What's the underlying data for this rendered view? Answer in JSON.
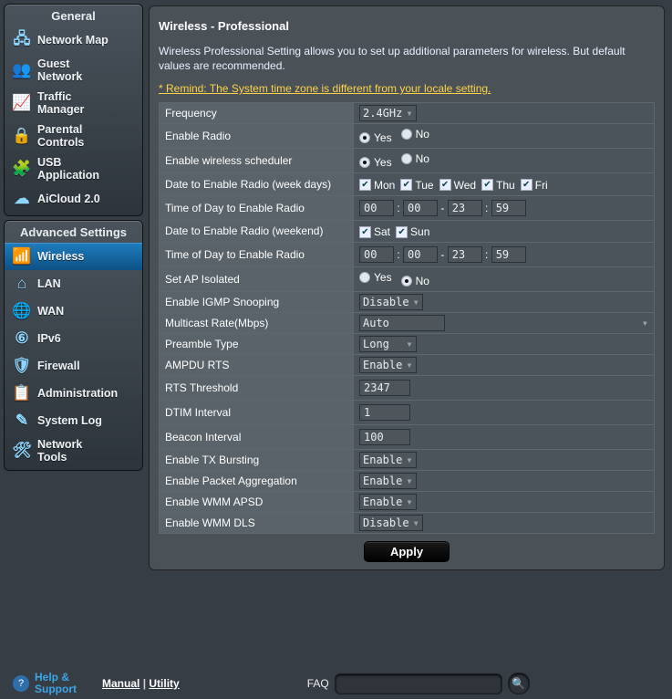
{
  "sidebar": {
    "general": {
      "header": "General",
      "items": [
        {
          "icon": "🖧",
          "label": "Network Map"
        },
        {
          "icon": "👥",
          "label": "Guest\nNetwork"
        },
        {
          "icon": "📈",
          "label": "Traffic\nManager"
        },
        {
          "icon": "🔒",
          "label": "Parental\nControls"
        },
        {
          "icon": "🧩",
          "label": "USB\nApplication"
        },
        {
          "icon": "☁",
          "label": "AiCloud 2.0"
        }
      ]
    },
    "advanced": {
      "header": "Advanced Settings",
      "items": [
        {
          "icon": "📶",
          "label": "Wireless",
          "active": true
        },
        {
          "icon": "⌂",
          "label": "LAN"
        },
        {
          "icon": "🌐",
          "label": "WAN"
        },
        {
          "icon": "⑥",
          "label": "IPv6"
        },
        {
          "icon": "🛡",
          "label": "Firewall"
        },
        {
          "icon": "📋",
          "label": "Administration"
        },
        {
          "icon": "✎",
          "label": "System Log"
        },
        {
          "icon": "🛠",
          "label": "Network\nTools"
        }
      ]
    }
  },
  "page": {
    "title": "Wireless - Professional",
    "description": "Wireless Professional Setting allows you to set up additional parameters for wireless. But default values are recommended.",
    "remind": "* Remind: The System time zone is different from your locale setting."
  },
  "fields": {
    "frequency": {
      "label": "Frequency",
      "value": "2.4GHz"
    },
    "enable_radio": {
      "label": "Enable Radio",
      "value": "Yes",
      "opts": [
        "Yes",
        "No"
      ]
    },
    "enable_sched": {
      "label": "Enable wireless scheduler",
      "value": "Yes",
      "opts": [
        "Yes",
        "No"
      ]
    },
    "weekdays": {
      "label": "Date to Enable Radio (week days)",
      "days": [
        "Mon",
        "Tue",
        "Wed",
        "Thu",
        "Fri"
      ]
    },
    "weekday_time": {
      "label": "Time of Day to Enable Radio",
      "h1": "00",
      "m1": "00",
      "h2": "23",
      "m2": "59"
    },
    "weekend": {
      "label": "Date to Enable Radio (weekend)",
      "days": [
        "Sat",
        "Sun"
      ]
    },
    "weekend_time": {
      "label": "Time of Day to Enable Radio",
      "h1": "00",
      "m1": "00",
      "h2": "23",
      "m2": "59"
    },
    "ap_isolated": {
      "label": "Set AP Isolated",
      "value": "No",
      "opts": [
        "Yes",
        "No"
      ]
    },
    "igmp": {
      "label": "Enable IGMP Snooping",
      "value": "Disable"
    },
    "mcast": {
      "label": "Multicast Rate(Mbps)",
      "value": "Auto"
    },
    "preamble": {
      "label": "Preamble Type",
      "value": "Long"
    },
    "ampdu": {
      "label": "AMPDU RTS",
      "value": "Enable"
    },
    "rts": {
      "label": "RTS Threshold",
      "value": "2347"
    },
    "dtim": {
      "label": "DTIM Interval",
      "value": "1"
    },
    "beacon": {
      "label": "Beacon Interval",
      "value": "100"
    },
    "txburst": {
      "label": "Enable TX Bursting",
      "value": "Enable"
    },
    "pktagg": {
      "label": "Enable Packet Aggregation",
      "value": "Enable"
    },
    "wmm_apsd": {
      "label": "Enable WMM APSD",
      "value": "Enable"
    },
    "wmm_dls": {
      "label": "Enable WMM DLS",
      "value": "Disable"
    }
  },
  "apply": "Apply",
  "footer": {
    "help": "Help &\nSupport",
    "manual": "Manual",
    "utility": "Utility",
    "faq": "FAQ",
    "search_ph": ""
  }
}
